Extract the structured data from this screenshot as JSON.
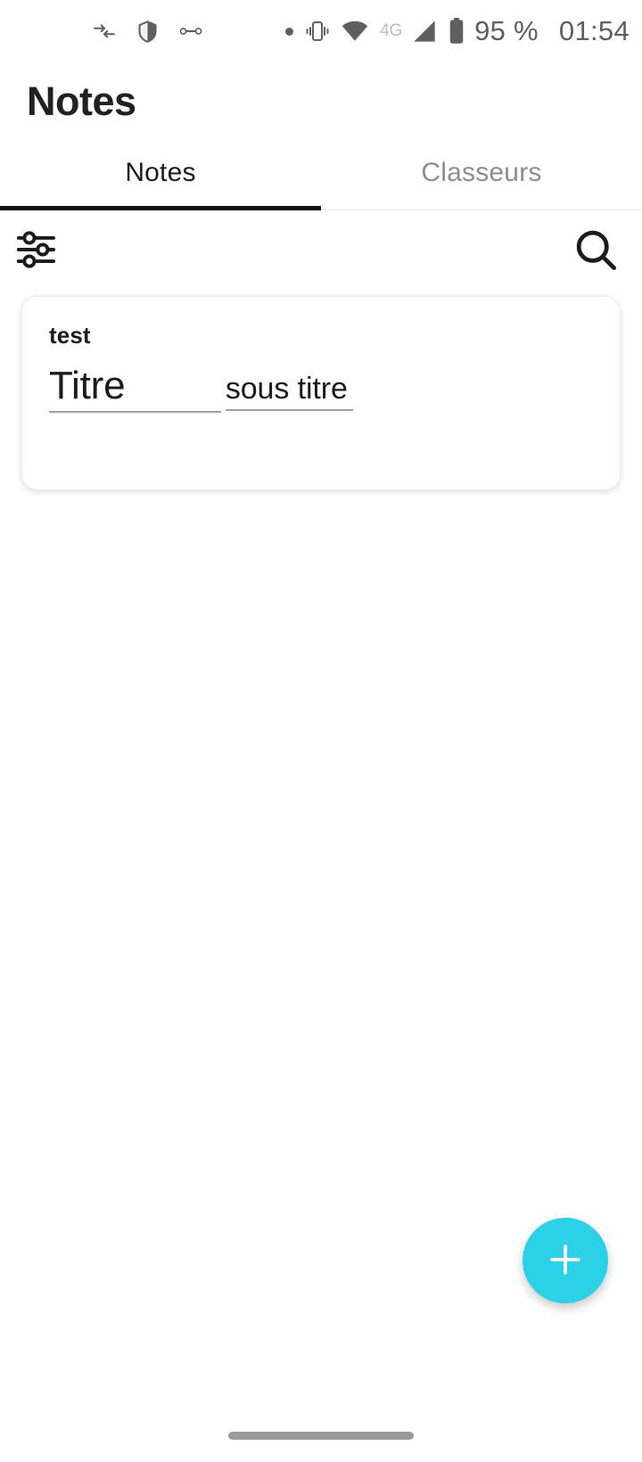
{
  "status_bar": {
    "left_icons": [
      "data-transfer-icon",
      "shield-icon",
      "link-icon"
    ],
    "right_icons": [
      "dot-indicator-icon",
      "vibrate-icon",
      "wifi-icon",
      "signal-icon",
      "battery-icon"
    ],
    "network_label": "4G",
    "battery_percent": "95 %",
    "time": "01:54",
    "icon_color": "#5f5f5f"
  },
  "app_bar": {
    "title": "Notes"
  },
  "tabs": {
    "items": [
      {
        "label": "Notes",
        "active": true
      },
      {
        "label": "Classeurs",
        "active": false
      }
    ],
    "indicator_color": "#111111",
    "active_color": "#1b1b1b",
    "inactive_color": "#8d8d8d"
  },
  "action_row": {
    "filter_icon": "filter-sliders-icon",
    "search_icon": "search-icon"
  },
  "notes": [
    {
      "tag": "test",
      "title": "Titre",
      "subtitle": "sous titre"
    }
  ],
  "fab": {
    "icon": "plus-icon",
    "color": "#2ad2e8"
  },
  "nav_bar": {
    "handle": "home-gesture-handle",
    "color": "#9a9a9a"
  }
}
